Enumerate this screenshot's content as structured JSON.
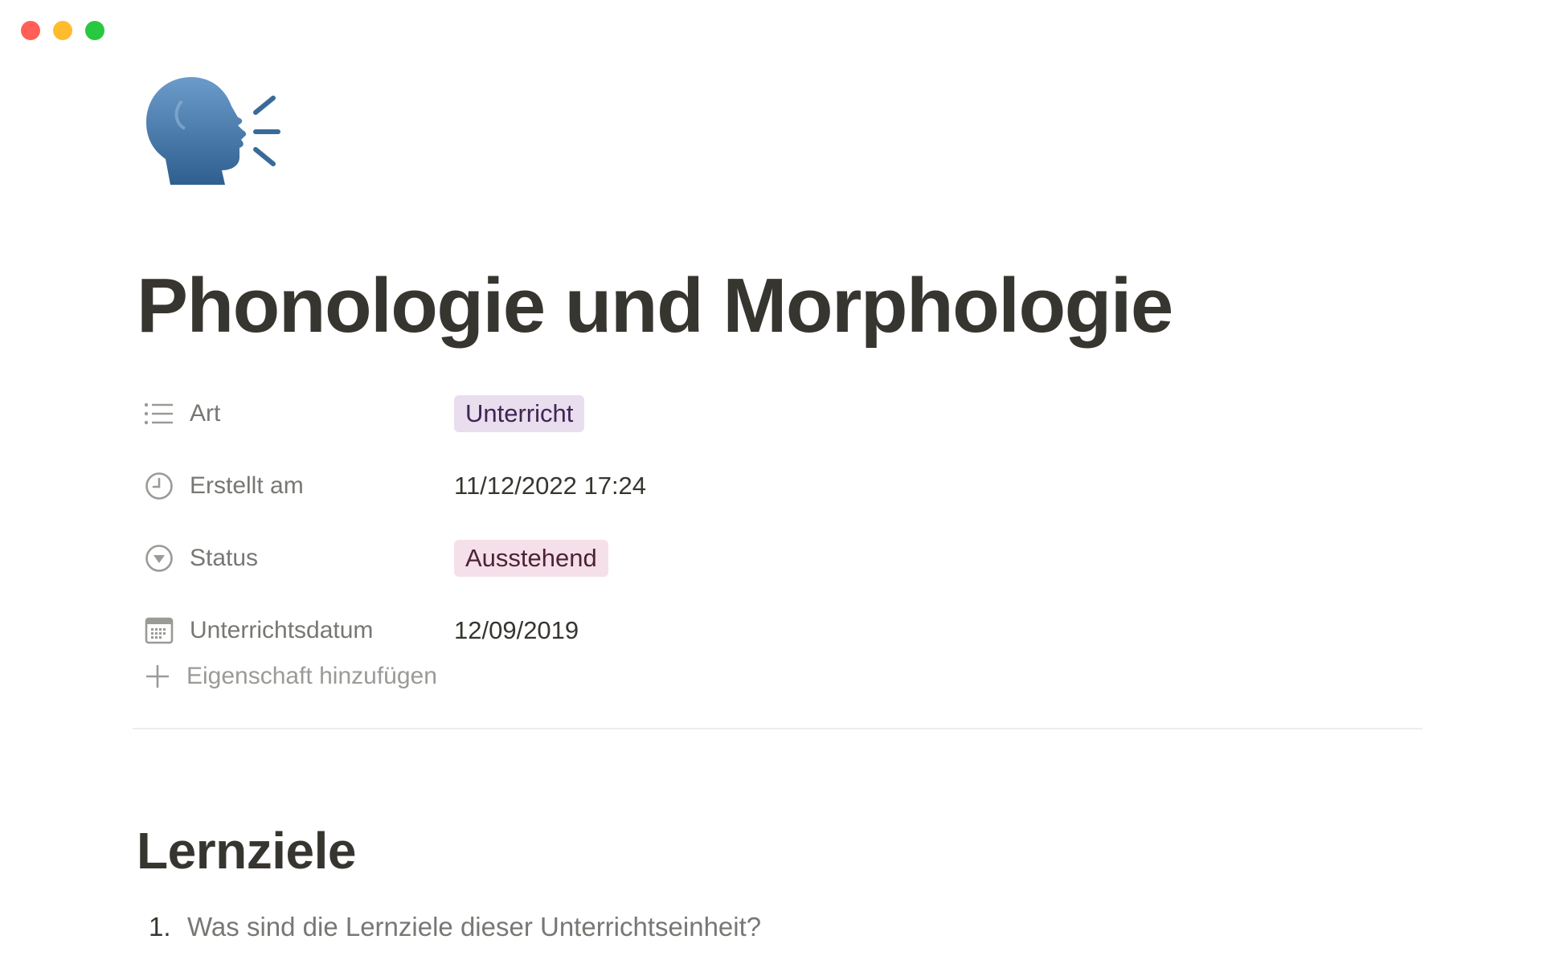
{
  "page": {
    "title": "Phonologie und Morphologie",
    "icon": "speaking-head-emoji"
  },
  "properties": [
    {
      "icon": "list-icon",
      "name": "Art",
      "value": "Unterricht",
      "type": "tag",
      "color": "#e8deee"
    },
    {
      "icon": "clock-icon",
      "name": "Erstellt am",
      "value": "11/12/2022 17:24",
      "type": "text"
    },
    {
      "icon": "status-icon",
      "name": "Status",
      "value": "Ausstehend",
      "type": "tag",
      "color": "#f5e0e9"
    },
    {
      "icon": "calendar-icon",
      "name": "Unterrichtsdatum",
      "value": "12/09/2019",
      "type": "text"
    }
  ],
  "add_property": {
    "icon": "plus-icon",
    "label": "Eigenschaft hinzufügen"
  },
  "content": {
    "heading": "Lernziele",
    "list": [
      {
        "number": "1.",
        "text": "Was sind die Lernziele dieser Unterrichtseinheit?"
      }
    ]
  },
  "colors": {
    "traffic_close": "#ff5f57",
    "traffic_minimize": "#febc2e",
    "traffic_maximize": "#28c840",
    "text_primary": "#37352f",
    "text_secondary": "#787774"
  }
}
